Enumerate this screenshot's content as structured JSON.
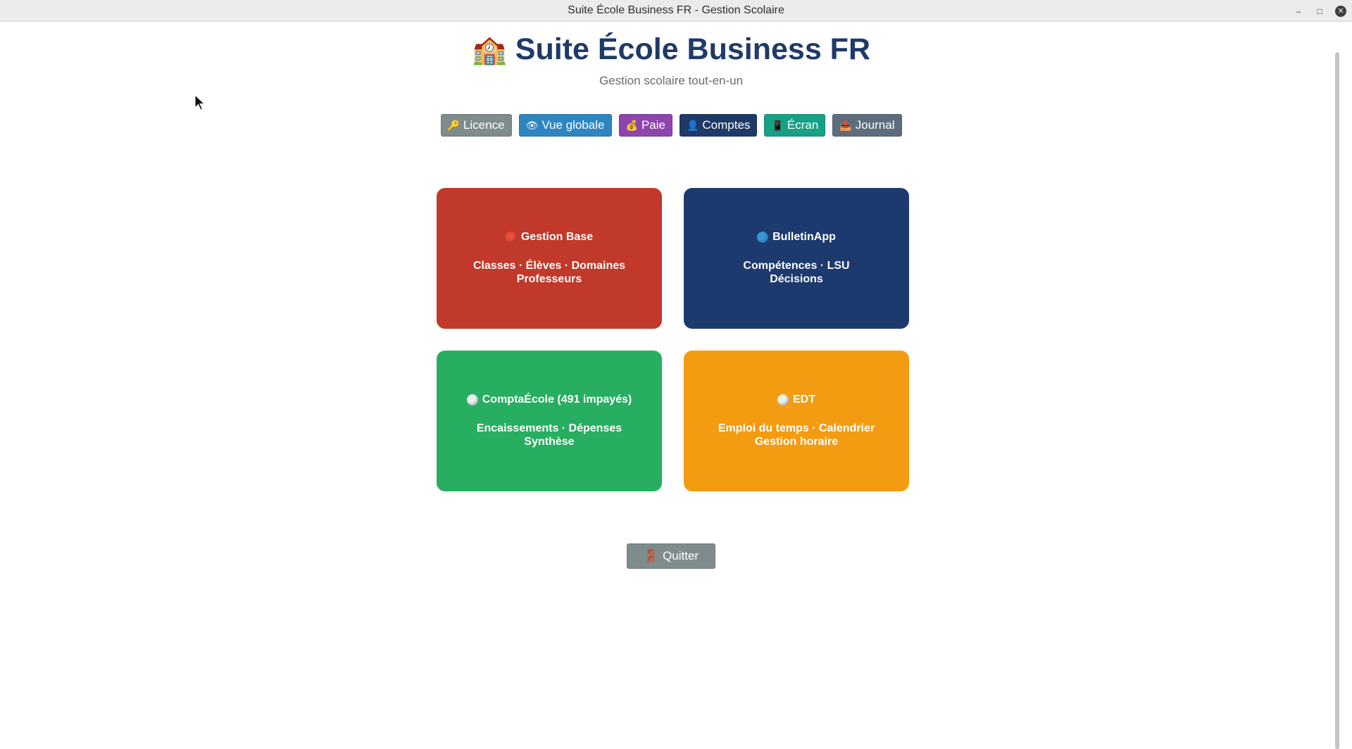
{
  "window": {
    "title": "Suite École Business FR - Gestion Scolaire",
    "controls": {
      "minimize": "–",
      "maximize": "□",
      "close": "✕"
    }
  },
  "header": {
    "logo_icon": "🏫",
    "title": "Suite École Business FR",
    "subtitle": "Gestion scolaire tout-en-un"
  },
  "nav": {
    "items": [
      {
        "icon": "🔑",
        "label": "Licence",
        "color": "#7f8c8d"
      },
      {
        "icon": "👁",
        "label": "Vue globale",
        "color": "#2e86c1"
      },
      {
        "icon": "💰",
        "label": "Paie",
        "color": "#8e44ad"
      },
      {
        "icon": "👤",
        "label": "Comptes",
        "color": "#1f3a68"
      },
      {
        "icon": "📱",
        "label": "Écran",
        "color": "#16a085"
      },
      {
        "icon": "📤",
        "label": "Journal",
        "color": "#5d6d7e"
      }
    ]
  },
  "tiles": [
    {
      "dot_color": "#e74c3c",
      "title": "Gestion Base",
      "line1": "Classes · Élèves · Domaines",
      "line2": "Professeurs",
      "color": "#c0392b"
    },
    {
      "dot_color": "#3498db",
      "title": "BulletinApp",
      "line1": "Compétences · LSU",
      "line2": "Décisions",
      "color": "#1c3a6e"
    },
    {
      "dot_color": "#ecf0f1",
      "title": "ComptaÉcole (491 impayés)",
      "line1": "Encaissements · Dépenses",
      "line2": "Synthèse",
      "color": "#27ae60"
    },
    {
      "dot_color": "#ecf0f1",
      "title": "EDT",
      "line1": "Emploi du temps · Calendrier",
      "line2": "Gestion horaire",
      "color": "#f39c12"
    }
  ],
  "quit": {
    "icon": "🚪",
    "label": "Quitter"
  }
}
